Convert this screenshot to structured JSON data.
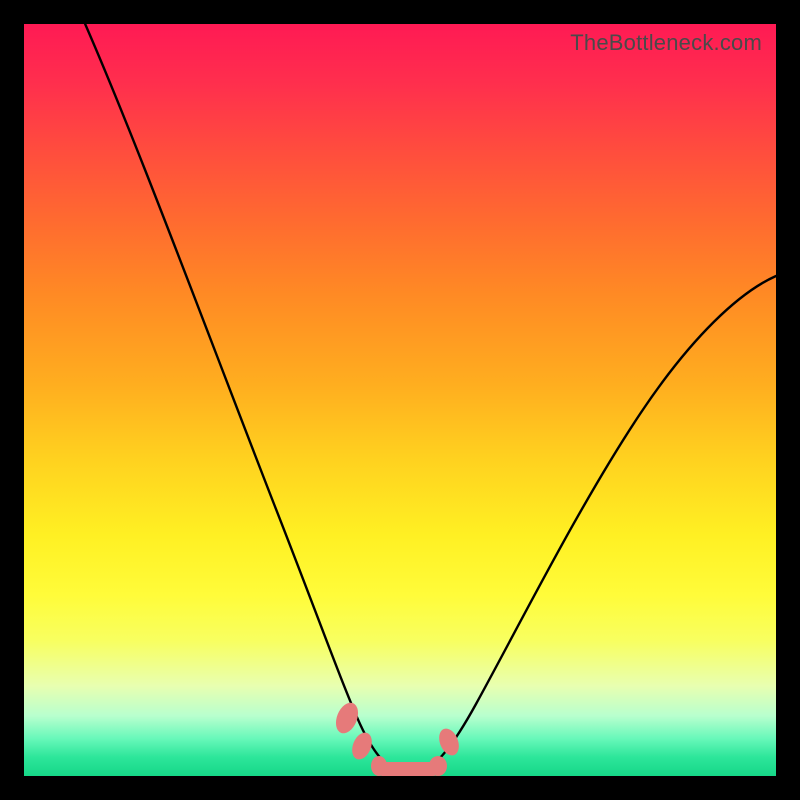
{
  "watermark": "TheBottleneck.com",
  "chart_data": {
    "type": "line",
    "title": "",
    "xlabel": "",
    "ylabel": "",
    "x": [
      0.0,
      0.05,
      0.1,
      0.15,
      0.2,
      0.25,
      0.3,
      0.35,
      0.4,
      0.43,
      0.46,
      0.49,
      0.52,
      0.55,
      0.6,
      0.65,
      0.7,
      0.75,
      0.8,
      0.85,
      0.9,
      0.95,
      1.0
    ],
    "series": [
      {
        "name": "left-curve",
        "values": [
          1.02,
          0.9,
          0.78,
          0.67,
          0.56,
          0.45,
          0.34,
          0.24,
          0.14,
          0.08,
          0.03,
          0.005,
          0.005,
          null,
          null,
          null,
          null,
          null,
          null,
          null,
          null,
          null,
          null
        ]
      },
      {
        "name": "right-curve",
        "values": [
          null,
          null,
          null,
          null,
          null,
          null,
          null,
          null,
          null,
          null,
          null,
          null,
          0.005,
          0.03,
          0.11,
          0.21,
          0.31,
          0.4,
          0.48,
          0.55,
          0.6,
          0.64,
          0.66
        ]
      }
    ],
    "xlim": [
      0,
      1
    ],
    "ylim": [
      0,
      1
    ],
    "annotations": [
      {
        "name": "marker-left-1",
        "x": 0.43,
        "y": 0.075
      },
      {
        "name": "marker-left-2",
        "x": 0.45,
        "y": 0.035
      },
      {
        "name": "marker-bottom",
        "x": 0.505,
        "y": 0.01
      },
      {
        "name": "marker-right",
        "x": 0.565,
        "y": 0.04
      }
    ]
  }
}
